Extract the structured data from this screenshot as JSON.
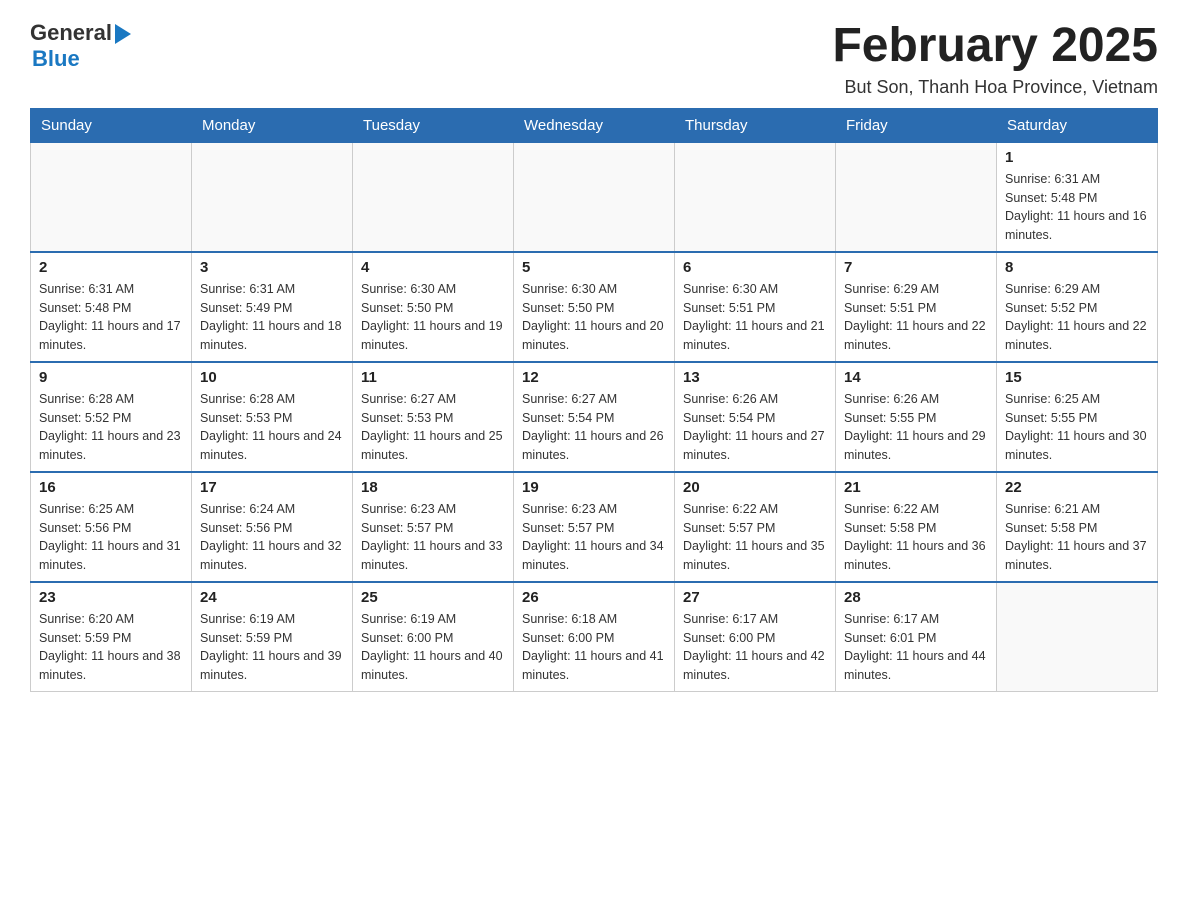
{
  "header": {
    "logo_general": "General",
    "logo_blue": "Blue",
    "month_title": "February 2025",
    "location": "But Son, Thanh Hoa Province, Vietnam"
  },
  "weekdays": [
    "Sunday",
    "Monday",
    "Tuesday",
    "Wednesday",
    "Thursday",
    "Friday",
    "Saturday"
  ],
  "weeks": [
    {
      "days": [
        {
          "date": "",
          "info": ""
        },
        {
          "date": "",
          "info": ""
        },
        {
          "date": "",
          "info": ""
        },
        {
          "date": "",
          "info": ""
        },
        {
          "date": "",
          "info": ""
        },
        {
          "date": "",
          "info": ""
        },
        {
          "date": "1",
          "info": "Sunrise: 6:31 AM\nSunset: 5:48 PM\nDaylight: 11 hours and 16 minutes."
        }
      ]
    },
    {
      "days": [
        {
          "date": "2",
          "info": "Sunrise: 6:31 AM\nSunset: 5:48 PM\nDaylight: 11 hours and 17 minutes."
        },
        {
          "date": "3",
          "info": "Sunrise: 6:31 AM\nSunset: 5:49 PM\nDaylight: 11 hours and 18 minutes."
        },
        {
          "date": "4",
          "info": "Sunrise: 6:30 AM\nSunset: 5:50 PM\nDaylight: 11 hours and 19 minutes."
        },
        {
          "date": "5",
          "info": "Sunrise: 6:30 AM\nSunset: 5:50 PM\nDaylight: 11 hours and 20 minutes."
        },
        {
          "date": "6",
          "info": "Sunrise: 6:30 AM\nSunset: 5:51 PM\nDaylight: 11 hours and 21 minutes."
        },
        {
          "date": "7",
          "info": "Sunrise: 6:29 AM\nSunset: 5:51 PM\nDaylight: 11 hours and 22 minutes."
        },
        {
          "date": "8",
          "info": "Sunrise: 6:29 AM\nSunset: 5:52 PM\nDaylight: 11 hours and 22 minutes."
        }
      ]
    },
    {
      "days": [
        {
          "date": "9",
          "info": "Sunrise: 6:28 AM\nSunset: 5:52 PM\nDaylight: 11 hours and 23 minutes."
        },
        {
          "date": "10",
          "info": "Sunrise: 6:28 AM\nSunset: 5:53 PM\nDaylight: 11 hours and 24 minutes."
        },
        {
          "date": "11",
          "info": "Sunrise: 6:27 AM\nSunset: 5:53 PM\nDaylight: 11 hours and 25 minutes."
        },
        {
          "date": "12",
          "info": "Sunrise: 6:27 AM\nSunset: 5:54 PM\nDaylight: 11 hours and 26 minutes."
        },
        {
          "date": "13",
          "info": "Sunrise: 6:26 AM\nSunset: 5:54 PM\nDaylight: 11 hours and 27 minutes."
        },
        {
          "date": "14",
          "info": "Sunrise: 6:26 AM\nSunset: 5:55 PM\nDaylight: 11 hours and 29 minutes."
        },
        {
          "date": "15",
          "info": "Sunrise: 6:25 AM\nSunset: 5:55 PM\nDaylight: 11 hours and 30 minutes."
        }
      ]
    },
    {
      "days": [
        {
          "date": "16",
          "info": "Sunrise: 6:25 AM\nSunset: 5:56 PM\nDaylight: 11 hours and 31 minutes."
        },
        {
          "date": "17",
          "info": "Sunrise: 6:24 AM\nSunset: 5:56 PM\nDaylight: 11 hours and 32 minutes."
        },
        {
          "date": "18",
          "info": "Sunrise: 6:23 AM\nSunset: 5:57 PM\nDaylight: 11 hours and 33 minutes."
        },
        {
          "date": "19",
          "info": "Sunrise: 6:23 AM\nSunset: 5:57 PM\nDaylight: 11 hours and 34 minutes."
        },
        {
          "date": "20",
          "info": "Sunrise: 6:22 AM\nSunset: 5:57 PM\nDaylight: 11 hours and 35 minutes."
        },
        {
          "date": "21",
          "info": "Sunrise: 6:22 AM\nSunset: 5:58 PM\nDaylight: 11 hours and 36 minutes."
        },
        {
          "date": "22",
          "info": "Sunrise: 6:21 AM\nSunset: 5:58 PM\nDaylight: 11 hours and 37 minutes."
        }
      ]
    },
    {
      "days": [
        {
          "date": "23",
          "info": "Sunrise: 6:20 AM\nSunset: 5:59 PM\nDaylight: 11 hours and 38 minutes."
        },
        {
          "date": "24",
          "info": "Sunrise: 6:19 AM\nSunset: 5:59 PM\nDaylight: 11 hours and 39 minutes."
        },
        {
          "date": "25",
          "info": "Sunrise: 6:19 AM\nSunset: 6:00 PM\nDaylight: 11 hours and 40 minutes."
        },
        {
          "date": "26",
          "info": "Sunrise: 6:18 AM\nSunset: 6:00 PM\nDaylight: 11 hours and 41 minutes."
        },
        {
          "date": "27",
          "info": "Sunrise: 6:17 AM\nSunset: 6:00 PM\nDaylight: 11 hours and 42 minutes."
        },
        {
          "date": "28",
          "info": "Sunrise: 6:17 AM\nSunset: 6:01 PM\nDaylight: 11 hours and 44 minutes."
        },
        {
          "date": "",
          "info": ""
        }
      ]
    }
  ]
}
